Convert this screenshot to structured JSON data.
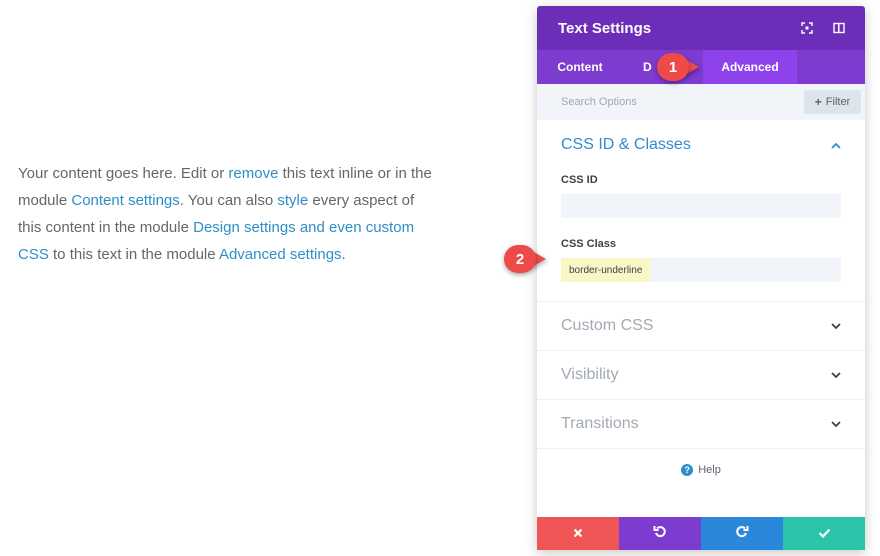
{
  "preview": {
    "t1": "Your content goes here. Edit or ",
    "l1": "remove",
    "t2": " this text inline or in the module ",
    "l2": "Content settings",
    "t3": ". You can also ",
    "l3": "style",
    "t4": " every aspect of this content in the module ",
    "l4": "Design settings and even custom CSS",
    "t5": " to this text in the module ",
    "l5": "Advanced settings",
    "t6": "."
  },
  "panel": {
    "title": "Text Settings",
    "tabs": {
      "content": "Content",
      "design": "D",
      "advanced": "Advanced"
    },
    "search_placeholder": "Search Options",
    "filter_label": "Filter",
    "css_section": {
      "title": "CSS ID & Classes",
      "css_id_label": "CSS ID",
      "css_id_value": "",
      "css_class_label": "CSS Class",
      "css_class_value": "border-underline"
    },
    "collapsed_sections": [
      "Custom CSS",
      "Visibility",
      "Transitions"
    ],
    "help_label": "Help"
  },
  "callouts": {
    "one": "1",
    "two": "2"
  },
  "colors": {
    "header": "#6c2eb9",
    "tabs": "#7d3bcf",
    "active_tab": "#8f42ec",
    "link": "#2e8fc8",
    "cancel": "#ef5555",
    "undo": "#7d3bcf",
    "redo": "#2b87da",
    "save": "#29c4a9",
    "callout": "#ef4a4a"
  },
  "icons": {
    "header": [
      "fullscreen-icon",
      "split-view-icon"
    ],
    "footer": [
      "close-icon",
      "undo-icon",
      "redo-icon",
      "check-icon"
    ]
  }
}
